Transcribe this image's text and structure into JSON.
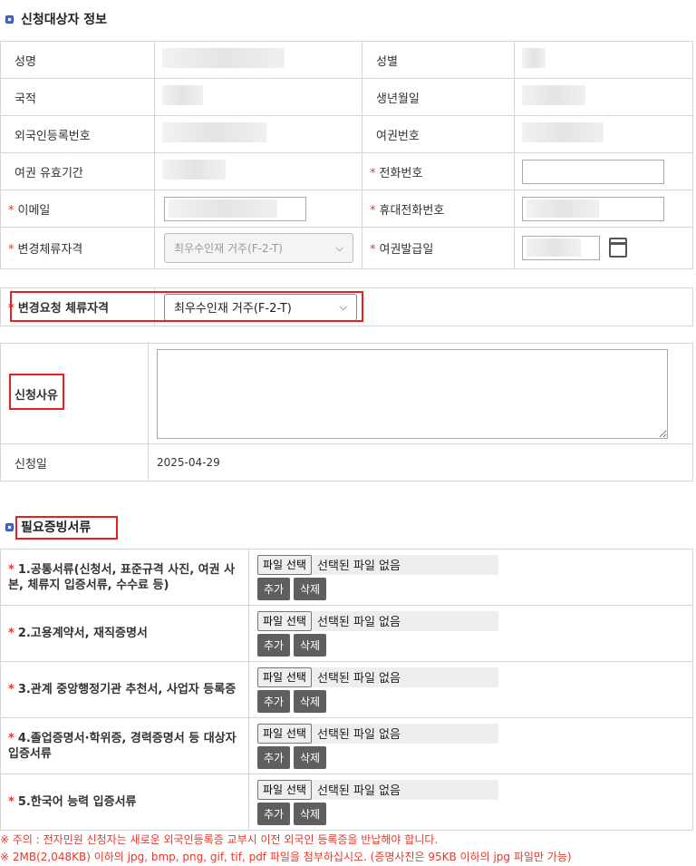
{
  "applicant_section": {
    "title": "신청대상자 정보",
    "name_label": "성명",
    "gender_label": "성별",
    "nationality_label": "국적",
    "birthdate_label": "생년월일",
    "alien_reg_label": "외국인등록번호",
    "passport_no_label": "여권번호",
    "passport_expiry_label": "여권 유효기간",
    "phone_label": "전화번호",
    "email_label": "이메일",
    "mobile_label": "휴대전화번호",
    "change_status_label": "변경체류자격",
    "change_status_value": "최우수인재 거주(F-2-T)",
    "passport_issue_label": "여권발급일",
    "required_mark": "*"
  },
  "request_status": {
    "label": "변경요청 체류자격",
    "value": "최우수인재 거주(F-2-T)"
  },
  "reason": {
    "label": "신청사유",
    "date_label": "신청일",
    "date_value": "2025-04-29"
  },
  "documents_section": {
    "title": "필요증빙서류",
    "file_button": "파일 선택",
    "no_file": "선택된 파일 없음",
    "add_button": "추가",
    "delete_button": "삭제",
    "items": [
      {
        "label": "1.공통서류(신청서, 표준규격 사진, 여권 사본, 체류지 입증서류, 수수료 등)"
      },
      {
        "label": "2.고용계약서, 재직증명서"
      },
      {
        "label": "3.관계 중앙행정기관 추천서, 사업자 등록증"
      },
      {
        "label": "4.졸업증명서·학위증, 경력증명서 등 대상자 입증서류"
      },
      {
        "label": "5.한국어 능력 입증서류"
      }
    ]
  },
  "notes": {
    "note1": "※ 주의 : 전자민원 신청자는 새로운 외국인등록증 교부시 이전 외국인 등록증을 반납해야 합니다.",
    "note2": "※ 2MB(2,048KB) 이하의 jpg, bmp, png, gif, tif, pdf 파일을 첨부하십시오. (증명사진은 95KB 이하의 jpg 파일만 가능)"
  },
  "colors": {
    "accent": "#4a6fd4",
    "required": "#e4392b",
    "highlight_box": "#e62020"
  }
}
